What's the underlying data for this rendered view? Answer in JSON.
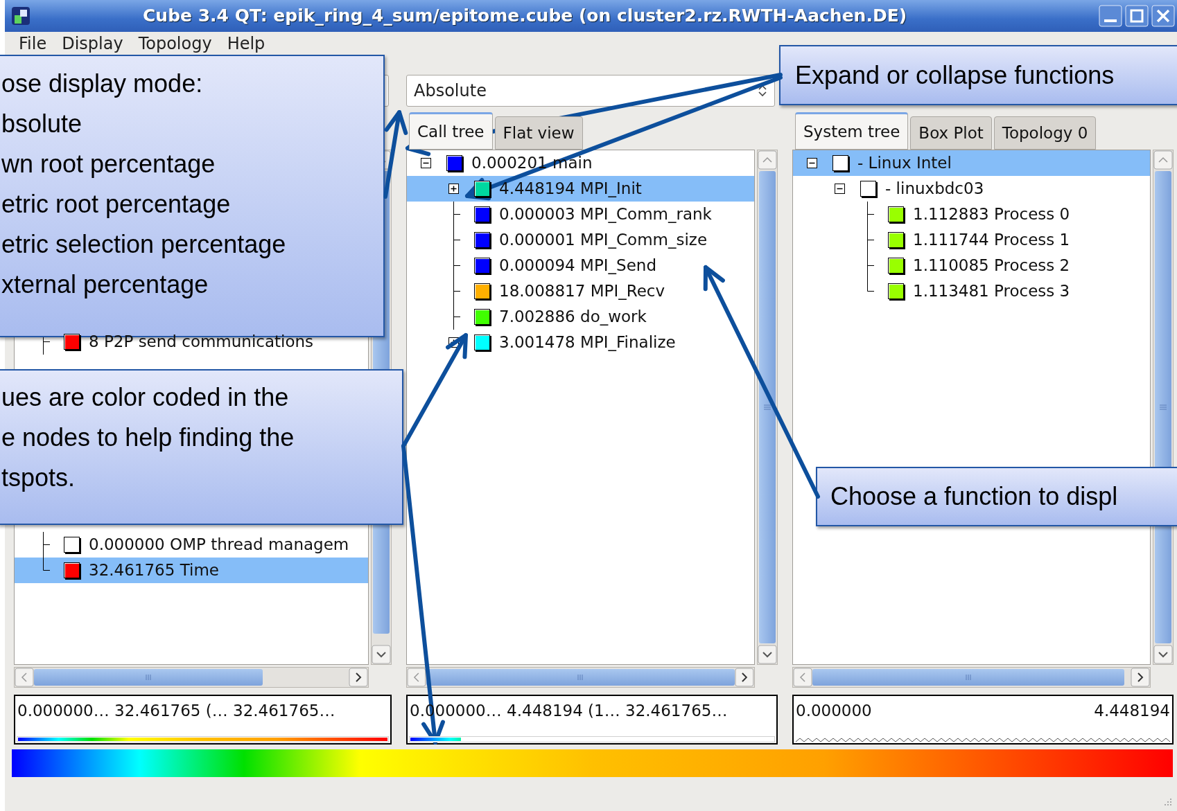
{
  "window": {
    "title": "Cube 3.4 QT: epik_ring_4_sum/epitome.cube (on cluster2.rz.RWTH-Aachen.DE)"
  },
  "menu": [
    "File",
    "Display",
    "Topology",
    "Help"
  ],
  "panels": [
    {
      "tree": [
        {
          "label": "8 P2P send communications",
          "color": "#ff0000",
          "selected": false
        },
        {
          "label": "0.000000 OMP thread managem",
          "color": "#ffffff",
          "selected": false
        },
        {
          "label": "32.461765 Time",
          "color": "#ff0000",
          "selected": true
        }
      ],
      "value_box": {
        "kind": "bar",
        "texts": [
          "0.000000… 32.461765 (… 32.461765…"
        ],
        "level": 1
      }
    },
    {
      "dropdown": {
        "value": "Absolute"
      },
      "tabs": [
        {
          "label": "Call tree",
          "selected": true
        },
        {
          "label": "Flat view",
          "selected": false
        }
      ],
      "tree": [
        {
          "label": "0.000201 main",
          "color": "#0000ff",
          "selected": false,
          "expanded": true,
          "children": [
            {
              "label": "4.448194 MPI_Init",
              "color": "#00d8a0",
              "selected": true,
              "expanded": false
            },
            {
              "label": "0.000003 MPI_Comm_rank",
              "color": "#0000ff",
              "selected": false
            },
            {
              "label": "0.000001 MPI_Comm_size",
              "color": "#0000ff",
              "selected": false
            },
            {
              "label": "0.000094 MPI_Send",
              "color": "#0000ff",
              "selected": false
            },
            {
              "label": "18.008817 MPI_Recv",
              "color": "#ffb000",
              "selected": false
            },
            {
              "label": "7.002886 do_work",
              "color": "#40ff00",
              "selected": false
            },
            {
              "label": "3.001478 MPI_Finalize",
              "color": "#00ffff",
              "selected": false,
              "expanded": false
            }
          ]
        }
      ],
      "value_box": {
        "kind": "bar",
        "texts": [
          "0.000000… 4.448194 (1… 32.461765…"
        ],
        "level": 0.14
      }
    },
    {
      "tabs": [
        {
          "label": "System tree",
          "selected": true
        },
        {
          "label": "Box Plot",
          "selected": false
        },
        {
          "label": "Topology 0",
          "selected": false
        }
      ],
      "tree": [
        {
          "label": "- Linux Intel",
          "color": "#ffffff",
          "selected": true,
          "expanded": true,
          "children": [
            {
              "label": "- linuxbdc03",
              "color": "#ffffff",
              "selected": false,
              "expanded": true,
              "children": [
                {
                  "label": "1.112883 Process 0",
                  "color": "#99ff00",
                  "selected": false
                },
                {
                  "label": "1.111744 Process 1",
                  "color": "#99ff00",
                  "selected": false
                },
                {
                  "label": "1.110085 Process 2",
                  "color": "#99ff00",
                  "selected": false
                },
                {
                  "label": "1.113481 Process 3",
                  "color": "#99ff00",
                  "selected": false
                }
              ]
            }
          ]
        }
      ],
      "value_box": {
        "kind": "zigzag",
        "texts": [
          "0.000000",
          "4.448194"
        ]
      }
    }
  ],
  "callouts": [
    {
      "lines": [
        "ose display mode:",
        "bsolute",
        "wn root percentage",
        "etric root percentage",
        "etric selection percentage",
        "xternal percentage"
      ]
    },
    {
      "lines": [
        "ues are color coded in the",
        "e nodes to help finding the",
        "tspots."
      ]
    },
    {
      "lines": [
        "Expand or collapse functions"
      ]
    },
    {
      "lines": [
        "Choose a function to displ"
      ]
    }
  ]
}
